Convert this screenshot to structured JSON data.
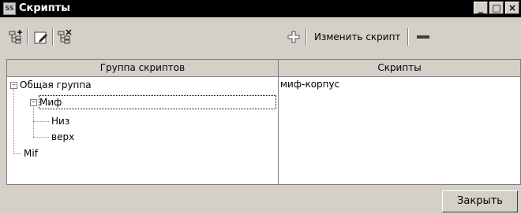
{
  "window": {
    "title": "Скрипты",
    "app_icon": "scripts-app-icon"
  },
  "title_buttons": {
    "minimize": "_",
    "maximize": "□",
    "close": "×"
  },
  "toolbar": {
    "add_group_icon": "add-tree-node-icon",
    "edit_group_icon": "edit-pencil-icon",
    "delete_group_icon": "delete-tree-node-icon",
    "add_script_icon": "plus-icon",
    "edit_script_label": "Изменить скрипт",
    "remove_script_icon": "minus-icon"
  },
  "groups": {
    "header": "Группа скриптов",
    "tree": {
      "root": "Общая группа",
      "child_myth": "Миф",
      "grandchild_low": "Низ",
      "grandchild_top": "верх",
      "child_mif": "Mif"
    }
  },
  "scripts": {
    "header": "Скрипты",
    "items": [
      "миф-корпус"
    ]
  },
  "footer": {
    "close_label": "Закрыть"
  }
}
